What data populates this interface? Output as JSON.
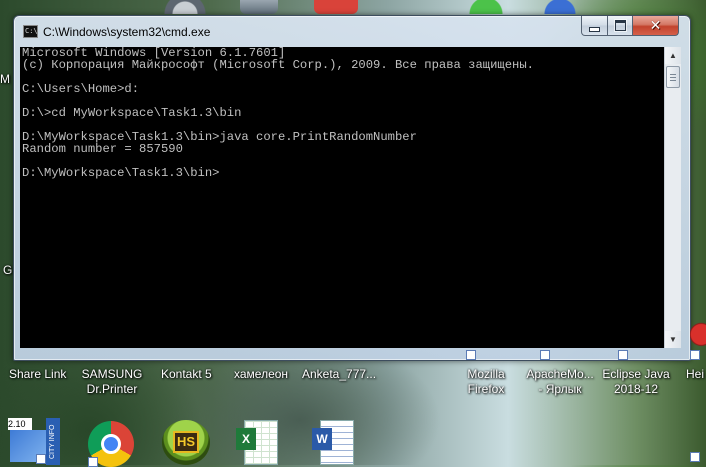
{
  "window": {
    "title": "C:\\Windows\\system32\\cmd.exe",
    "icon_text": "C:\\"
  },
  "console": {
    "lines": [
      "Microsoft Windows [Version 6.1.7601]",
      "(c) Корпорация Майкрософт (Microsoft Corp.), 2009. Все права защищены.",
      "",
      "C:\\Users\\Home>d:",
      "",
      "D:\\>cd MyWorkspace\\Task1.3\\bin",
      "",
      "D:\\MyWorkspace\\Task1.3\\bin>java core.PrintRandomNumber",
      "Random number = 857590",
      "",
      "D:\\MyWorkspace\\Task1.3\\bin>"
    ]
  },
  "desktop": {
    "icons": [
      {
        "label": "Share Link"
      },
      {
        "label": "SAMSUNG Dr.Printer"
      },
      {
        "label": "Kontakt 5"
      },
      {
        "label": "хамелеон"
      },
      {
        "label": "Anketa_777..."
      },
      {
        "label": "Mozilla Firefox"
      },
      {
        "label": "ApacheMo... - Ярлык"
      },
      {
        "label": "Eclipse Java 2018-12"
      },
      {
        "label": "Hei"
      }
    ],
    "left_edge_fragments": [
      "M",
      "G"
    ],
    "bottom_icons": [
      {
        "name": "city-info",
        "text": "2.10 CITY INFO"
      },
      {
        "name": "chrome"
      },
      {
        "name": "hs",
        "text": "HS"
      },
      {
        "name": "excel"
      },
      {
        "name": "word"
      }
    ]
  }
}
